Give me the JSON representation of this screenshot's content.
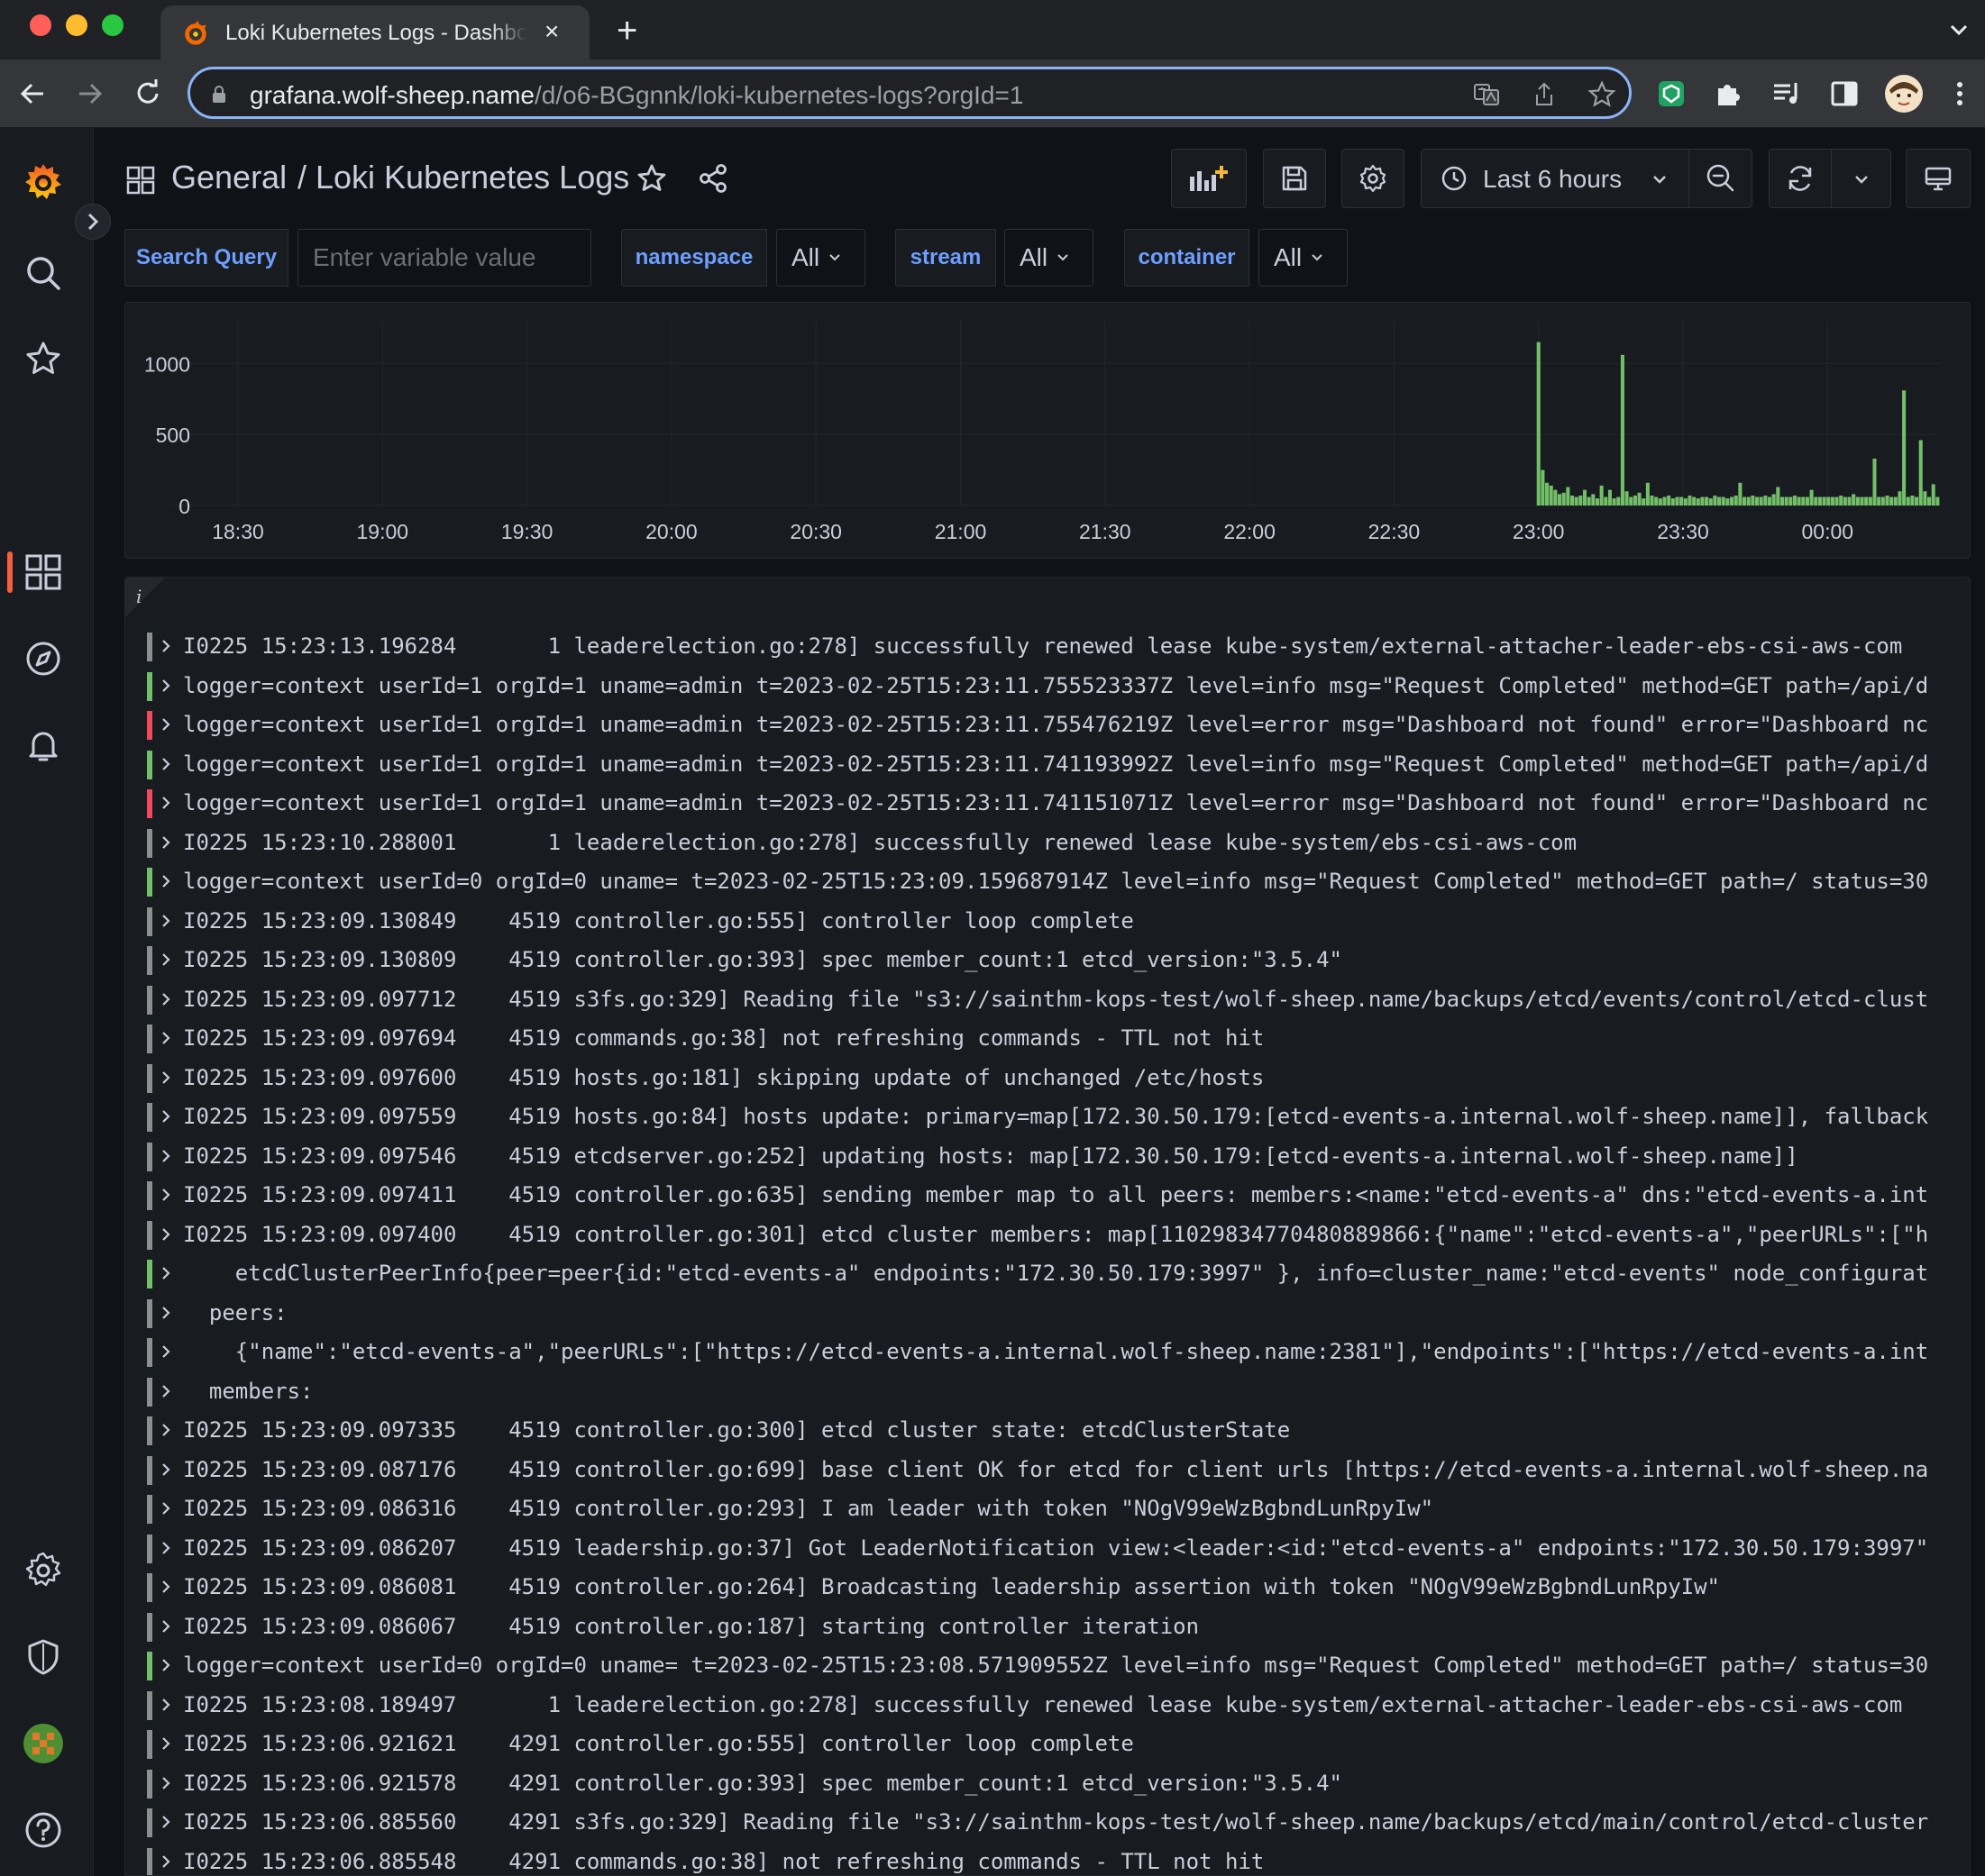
{
  "browser": {
    "tab_title": "Loki Kubernetes Logs - Dashboard",
    "url_host": "grafana.wolf-sheep.name",
    "url_path": "/d/o6-BGgnnk/loki-kubernetes-logs?orgId=1"
  },
  "header": {
    "folder": "General",
    "title": "/ Loki Kubernetes Logs",
    "time_range": "Last 6 hours"
  },
  "variables": {
    "search_label": "Search Query",
    "search_placeholder": "Enter variable value",
    "namespace_label": "namespace",
    "namespace_value": "All",
    "stream_label": "stream",
    "stream_value": "All",
    "container_label": "container",
    "container_value": "All"
  },
  "chart_data": {
    "type": "bar",
    "title": "",
    "xlabel": "",
    "ylabel": "",
    "x_tick_labels": [
      "18:30",
      "19:00",
      "19:30",
      "20:00",
      "20:30",
      "21:00",
      "21:30",
      "22:00",
      "22:30",
      "23:00",
      "23:30",
      "00:00"
    ],
    "y_tick_labels": [
      "0",
      "500",
      "1000"
    ],
    "ylim": [
      0,
      1300
    ],
    "series_color": "#73bf69",
    "series": [
      {
        "values": [
          1150,
          250,
          160,
          140,
          110,
          80,
          90,
          130,
          70,
          60,
          70,
          110,
          60,
          80,
          50,
          140,
          60,
          110,
          50,
          60,
          1060,
          100,
          60,
          70,
          90,
          50,
          160,
          70,
          60,
          50,
          60,
          70,
          50,
          60,
          60,
          50,
          70,
          60,
          50,
          60,
          60,
          50,
          70,
          60,
          60,
          50,
          60,
          70,
          160,
          60,
          60,
          70,
          60,
          60,
          70,
          60,
          80,
          130,
          60,
          60,
          60,
          70,
          60,
          60,
          60,
          110,
          60,
          60,
          60,
          60,
          60,
          60,
          70,
          60,
          60,
          80,
          60,
          60,
          60,
          60,
          330,
          60,
          60,
          70,
          60,
          60,
          100,
          810,
          60,
          70,
          60,
          460,
          100,
          60,
          150,
          60
        ]
      }
    ]
  },
  "logs": [
    {
      "level": "unknown",
      "text": "I0225 15:23:13.196284       1 leaderelection.go:278] successfully renewed lease kube-system/external-attacher-leader-ebs-csi-aws-com"
    },
    {
      "level": "info",
      "text": "logger=context userId=1 orgId=1 uname=admin t=2023-02-25T15:23:11.755523337Z level=info msg=\"Request Completed\" method=GET path=/api/d"
    },
    {
      "level": "error",
      "text": "logger=context userId=1 orgId=1 uname=admin t=2023-02-25T15:23:11.755476219Z level=error msg=\"Dashboard not found\" error=\"Dashboard nc"
    },
    {
      "level": "info",
      "text": "logger=context userId=1 orgId=1 uname=admin t=2023-02-25T15:23:11.741193992Z level=info msg=\"Request Completed\" method=GET path=/api/d"
    },
    {
      "level": "error",
      "text": "logger=context userId=1 orgId=1 uname=admin t=2023-02-25T15:23:11.741151071Z level=error msg=\"Dashboard not found\" error=\"Dashboard nc"
    },
    {
      "level": "unknown",
      "text": "I0225 15:23:10.288001       1 leaderelection.go:278] successfully renewed lease kube-system/ebs-csi-aws-com"
    },
    {
      "level": "info",
      "text": "logger=context userId=0 orgId=0 uname= t=2023-02-25T15:23:09.159687914Z level=info msg=\"Request Completed\" method=GET path=/ status=30"
    },
    {
      "level": "unknown",
      "text": "I0225 15:23:09.130849    4519 controller.go:555] controller loop complete"
    },
    {
      "level": "unknown",
      "text": "I0225 15:23:09.130809    4519 controller.go:393] spec member_count:1 etcd_version:\"3.5.4\""
    },
    {
      "level": "unknown",
      "text": "I0225 15:23:09.097712    4519 s3fs.go:329] Reading file \"s3://sainthm-kops-test/wolf-sheep.name/backups/etcd/events/control/etcd-clust"
    },
    {
      "level": "unknown",
      "text": "I0225 15:23:09.097694    4519 commands.go:38] not refreshing commands - TTL not hit"
    },
    {
      "level": "unknown",
      "text": "I0225 15:23:09.097600    4519 hosts.go:181] skipping update of unchanged /etc/hosts"
    },
    {
      "level": "unknown",
      "text": "I0225 15:23:09.097559    4519 hosts.go:84] hosts update: primary=map[172.30.50.179:[etcd-events-a.internal.wolf-sheep.name]], fallback"
    },
    {
      "level": "unknown",
      "text": "I0225 15:23:09.097546    4519 etcdserver.go:252] updating hosts: map[172.30.50.179:[etcd-events-a.internal.wolf-sheep.name]]"
    },
    {
      "level": "unknown",
      "text": "I0225 15:23:09.097411    4519 controller.go:635] sending member map to all peers: members:<name:\"etcd-events-a\" dns:\"etcd-events-a.int"
    },
    {
      "level": "unknown",
      "text": "I0225 15:23:09.097400    4519 controller.go:301] etcd cluster members: map[11029834770480889866:{\"name\":\"etcd-events-a\",\"peerURLs\":[\"h"
    },
    {
      "level": "info",
      "text": "    etcdClusterPeerInfo{peer=peer{id:\"etcd-events-a\" endpoints:\"172.30.50.179:3997\" }, info=cluster_name:\"etcd-events\" node_configurat"
    },
    {
      "level": "unknown",
      "text": "  peers:"
    },
    {
      "level": "unknown",
      "text": "    {\"name\":\"etcd-events-a\",\"peerURLs\":[\"https://etcd-events-a.internal.wolf-sheep.name:2381\"],\"endpoints\":[\"https://etcd-events-a.int"
    },
    {
      "level": "unknown",
      "text": "  members:"
    },
    {
      "level": "unknown",
      "text": "I0225 15:23:09.097335    4519 controller.go:300] etcd cluster state: etcdClusterState"
    },
    {
      "level": "unknown",
      "text": "I0225 15:23:09.087176    4519 controller.go:699] base client OK for etcd for client urls [https://etcd-events-a.internal.wolf-sheep.na"
    },
    {
      "level": "unknown",
      "text": "I0225 15:23:09.086316    4519 controller.go:293] I am leader with token \"NOgV99eWzBgbndLunRpyIw\""
    },
    {
      "level": "unknown",
      "text": "I0225 15:23:09.086207    4519 leadership.go:37] Got LeaderNotification view:<leader:<id:\"etcd-events-a\" endpoints:\"172.30.50.179:3997\""
    },
    {
      "level": "unknown",
      "text": "I0225 15:23:09.086081    4519 controller.go:264] Broadcasting leadership assertion with token \"NOgV99eWzBgbndLunRpyIw\""
    },
    {
      "level": "unknown",
      "text": "I0225 15:23:09.086067    4519 controller.go:187] starting controller iteration"
    },
    {
      "level": "info",
      "text": "logger=context userId=0 orgId=0 uname= t=2023-02-25T15:23:08.571909552Z level=info msg=\"Request Completed\" method=GET path=/ status=30"
    },
    {
      "level": "unknown",
      "text": "I0225 15:23:08.189497       1 leaderelection.go:278] successfully renewed lease kube-system/external-attacher-leader-ebs-csi-aws-com"
    },
    {
      "level": "unknown",
      "text": "I0225 15:23:06.921621    4291 controller.go:555] controller loop complete"
    },
    {
      "level": "unknown",
      "text": "I0225 15:23:06.921578    4291 controller.go:393] spec member_count:1 etcd_version:\"3.5.4\""
    },
    {
      "level": "unknown",
      "text": "I0225 15:23:06.885560    4291 s3fs.go:329] Reading file \"s3://sainthm-kops-test/wolf-sheep.name/backups/etcd/main/control/etcd-cluster"
    },
    {
      "level": "unknown",
      "text": "I0225 15:23:06.885548    4291 commands.go:38] not refreshing commands - TTL not hit"
    }
  ],
  "level_colors": {
    "info": "#73bf69",
    "error": "#f2495c",
    "unknown": "#8e8e8e"
  }
}
